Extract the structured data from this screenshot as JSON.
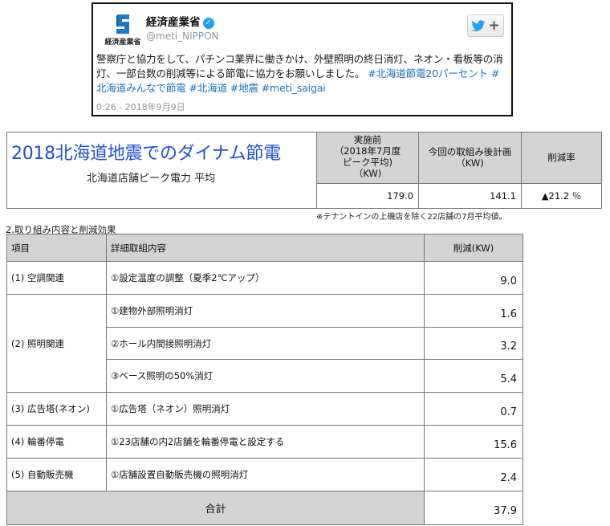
{
  "tweet": {
    "logo_text": "経済産業省",
    "name": "経済産業省",
    "verified_icon": "verified-check-icon",
    "handle": "@meti_NIPPON",
    "follow_icon": "twitter-bird-icon",
    "follow_plus": "+",
    "text_main": "警察庁と協力をして、パチンコ業界に働きかけ、外壁照明の終日消灯、ネオン・看板等の消灯、一部台数の削減等による節電に協力をお願いしました。",
    "hashtags": [
      "#北海道節電20パーセント",
      "#北海道みんなで節電",
      "#北海道",
      "#地震",
      "#meti_saigai"
    ],
    "time": "0:26 - 2018年9月9日"
  },
  "summary": {
    "title": "2018北海道地震でのダイナム節電",
    "subtitle": "北海道店舗ピーク電力 平均",
    "col_before": [
      "実施前",
      "（2018年7月度",
      "ピーク平均)",
      "（KW)"
    ],
    "col_plan": [
      "今回の取組み後計画",
      "（KW)"
    ],
    "col_rate": "削減率",
    "before_value": "179.0",
    "plan_value": "141.1",
    "rate_value": "▲21.2 ％",
    "note": "※テナントインの上磯店を除く22店舗の7月平均値。"
  },
  "detail": {
    "section_label": "2.取り組み内容と削減効果",
    "headers": {
      "item": "項目",
      "content": "詳細取組内容",
      "reduction": "削減(KW)"
    },
    "rows": [
      {
        "category": "(1) 空調関連",
        "content": "①設定温度の調整（夏季2℃アップ）",
        "value": "9.0"
      },
      {
        "category": "(2) 照明関連",
        "content": "①建物外部照明消灯",
        "value": "1.6"
      },
      {
        "category": "",
        "content": "②ホール内間接照明消灯",
        "value": "3.2"
      },
      {
        "category": "",
        "content": "③ベース照明の50%消灯",
        "value": "5.4"
      },
      {
        "category": "(3) 広告塔(ネオン)",
        "content": "①広告塔（ネオン）照明消灯",
        "value": "0.7"
      },
      {
        "category": "(4) 輪番停電",
        "content": "①23店舗の内2店舗を輪番停電と設定する",
        "value": "15.6"
      },
      {
        "category": "(5) 自動販売機",
        "content": "①店舗設置自動販売機の照明消灯",
        "value": "2.4"
      }
    ],
    "total_label": "合計",
    "total_value": "37.9"
  }
}
